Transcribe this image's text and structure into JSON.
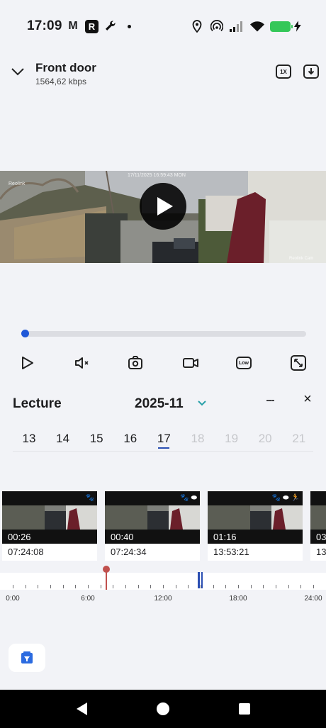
{
  "status_bar": {
    "time": "17:09",
    "icons": [
      "gmail-icon",
      "r-app-icon",
      "wrench-icon",
      "dot-icon",
      "location-icon",
      "hotspot-icon",
      "signal-icon",
      "wifi-icon",
      "battery-charging-icon"
    ],
    "r_app_letter": "R",
    "gmail_letter": "M"
  },
  "header": {
    "title": "Front door",
    "bitrate": "1564,62 kbps",
    "speed_label": "1X"
  },
  "video": {
    "timestamp": "17/11/2025 16:59:43 MON",
    "brand": "Reolink",
    "brand_corner": "Reolink Cam",
    "progress_fraction": 0.0
  },
  "controls": {
    "quality_label": "Low"
  },
  "recordings": {
    "title": "Lecture",
    "year_month": "2025-11",
    "more_label": "---",
    "close_label": "×",
    "days": [
      {
        "label": "13",
        "enabled": true,
        "selected": false
      },
      {
        "label": "14",
        "enabled": true,
        "selected": false
      },
      {
        "label": "15",
        "enabled": true,
        "selected": false
      },
      {
        "label": "16",
        "enabled": true,
        "selected": false
      },
      {
        "label": "17",
        "enabled": true,
        "selected": true
      },
      {
        "label": "18",
        "enabled": false,
        "selected": false
      },
      {
        "label": "19",
        "enabled": false,
        "selected": false
      },
      {
        "label": "20",
        "enabled": false,
        "selected": false
      },
      {
        "label": "21",
        "enabled": false,
        "selected": false
      }
    ],
    "clips": [
      {
        "duration": "00:26",
        "time": "07:24:08",
        "badges": [
          "paw"
        ]
      },
      {
        "duration": "00:40",
        "time": "07:24:34",
        "badges": [
          "paw",
          "vehicle"
        ]
      },
      {
        "duration": "01:16",
        "time": "13:53:21",
        "badges": [
          "paw",
          "vehicle",
          "person"
        ]
      },
      {
        "duration": "03",
        "time": "13",
        "badges": []
      }
    ]
  },
  "timeline": {
    "labels": [
      "0:00",
      "6:00",
      "12:00",
      "18:00",
      "24:00"
    ],
    "current_hour": 7.4,
    "event_hours": [
      14.75,
      14.85,
      15.05
    ],
    "colors": {
      "marker": "#c0504d",
      "event": "#2b4fb2"
    }
  },
  "colors": {
    "accent": "#2058d8",
    "background": "#f2f3f7"
  }
}
